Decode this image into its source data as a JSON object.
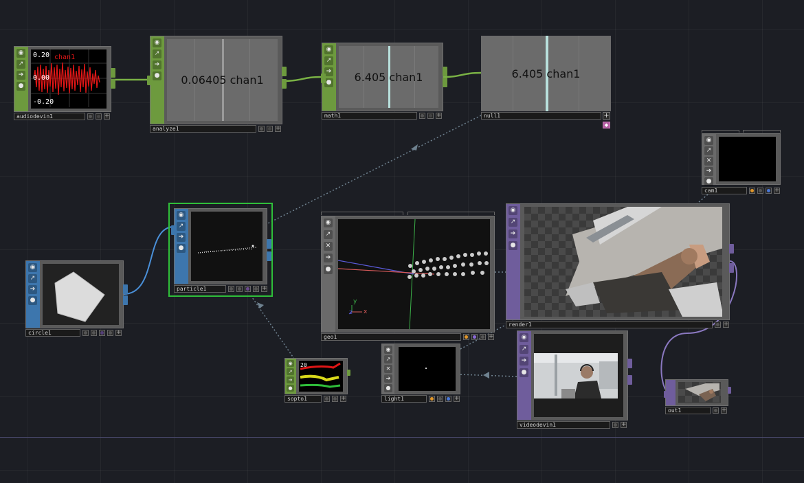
{
  "nodes": {
    "audiodevin1": {
      "name": "audiodevin1",
      "channel": "chan1",
      "scale_top": "0.20",
      "scale_mid": "0.00",
      "scale_bottom": "-0.20"
    },
    "analyze1": {
      "name": "analyze1",
      "value": "0.06405 chan1"
    },
    "math1": {
      "name": "math1",
      "value": "6.405 chan1"
    },
    "null1": {
      "name": "null1",
      "value": "6.405 chan1"
    },
    "cam1": {
      "name": "cam1"
    },
    "particle1": {
      "name": "particle1"
    },
    "circle1": {
      "name": "circle1"
    },
    "geo1": {
      "name": "geo1",
      "axis_y": "y",
      "axis_x": "x",
      "axis_z": "z"
    },
    "render1": {
      "name": "render1"
    },
    "sopto1": {
      "name": "sopto1",
      "scale_top": "20"
    },
    "light1": {
      "name": "light1"
    },
    "videodevin1": {
      "name": "videodevin1"
    },
    "out1": {
      "name": "out1"
    }
  },
  "icons": [
    "viewer-icon",
    "bypass-icon",
    "display-icon",
    "lock-icon",
    "cooking-icon",
    "plus-icon"
  ],
  "colors": {
    "chop": "#6d9a3e",
    "sop": "#3d76ad",
    "top": "#6f5d9c",
    "comp": "#6a6a6a",
    "wire_chop": "#7ab245",
    "wire_sop": "#4a90d9",
    "wire_top": "#8a78c0",
    "wire_ref": "#6f8290"
  }
}
